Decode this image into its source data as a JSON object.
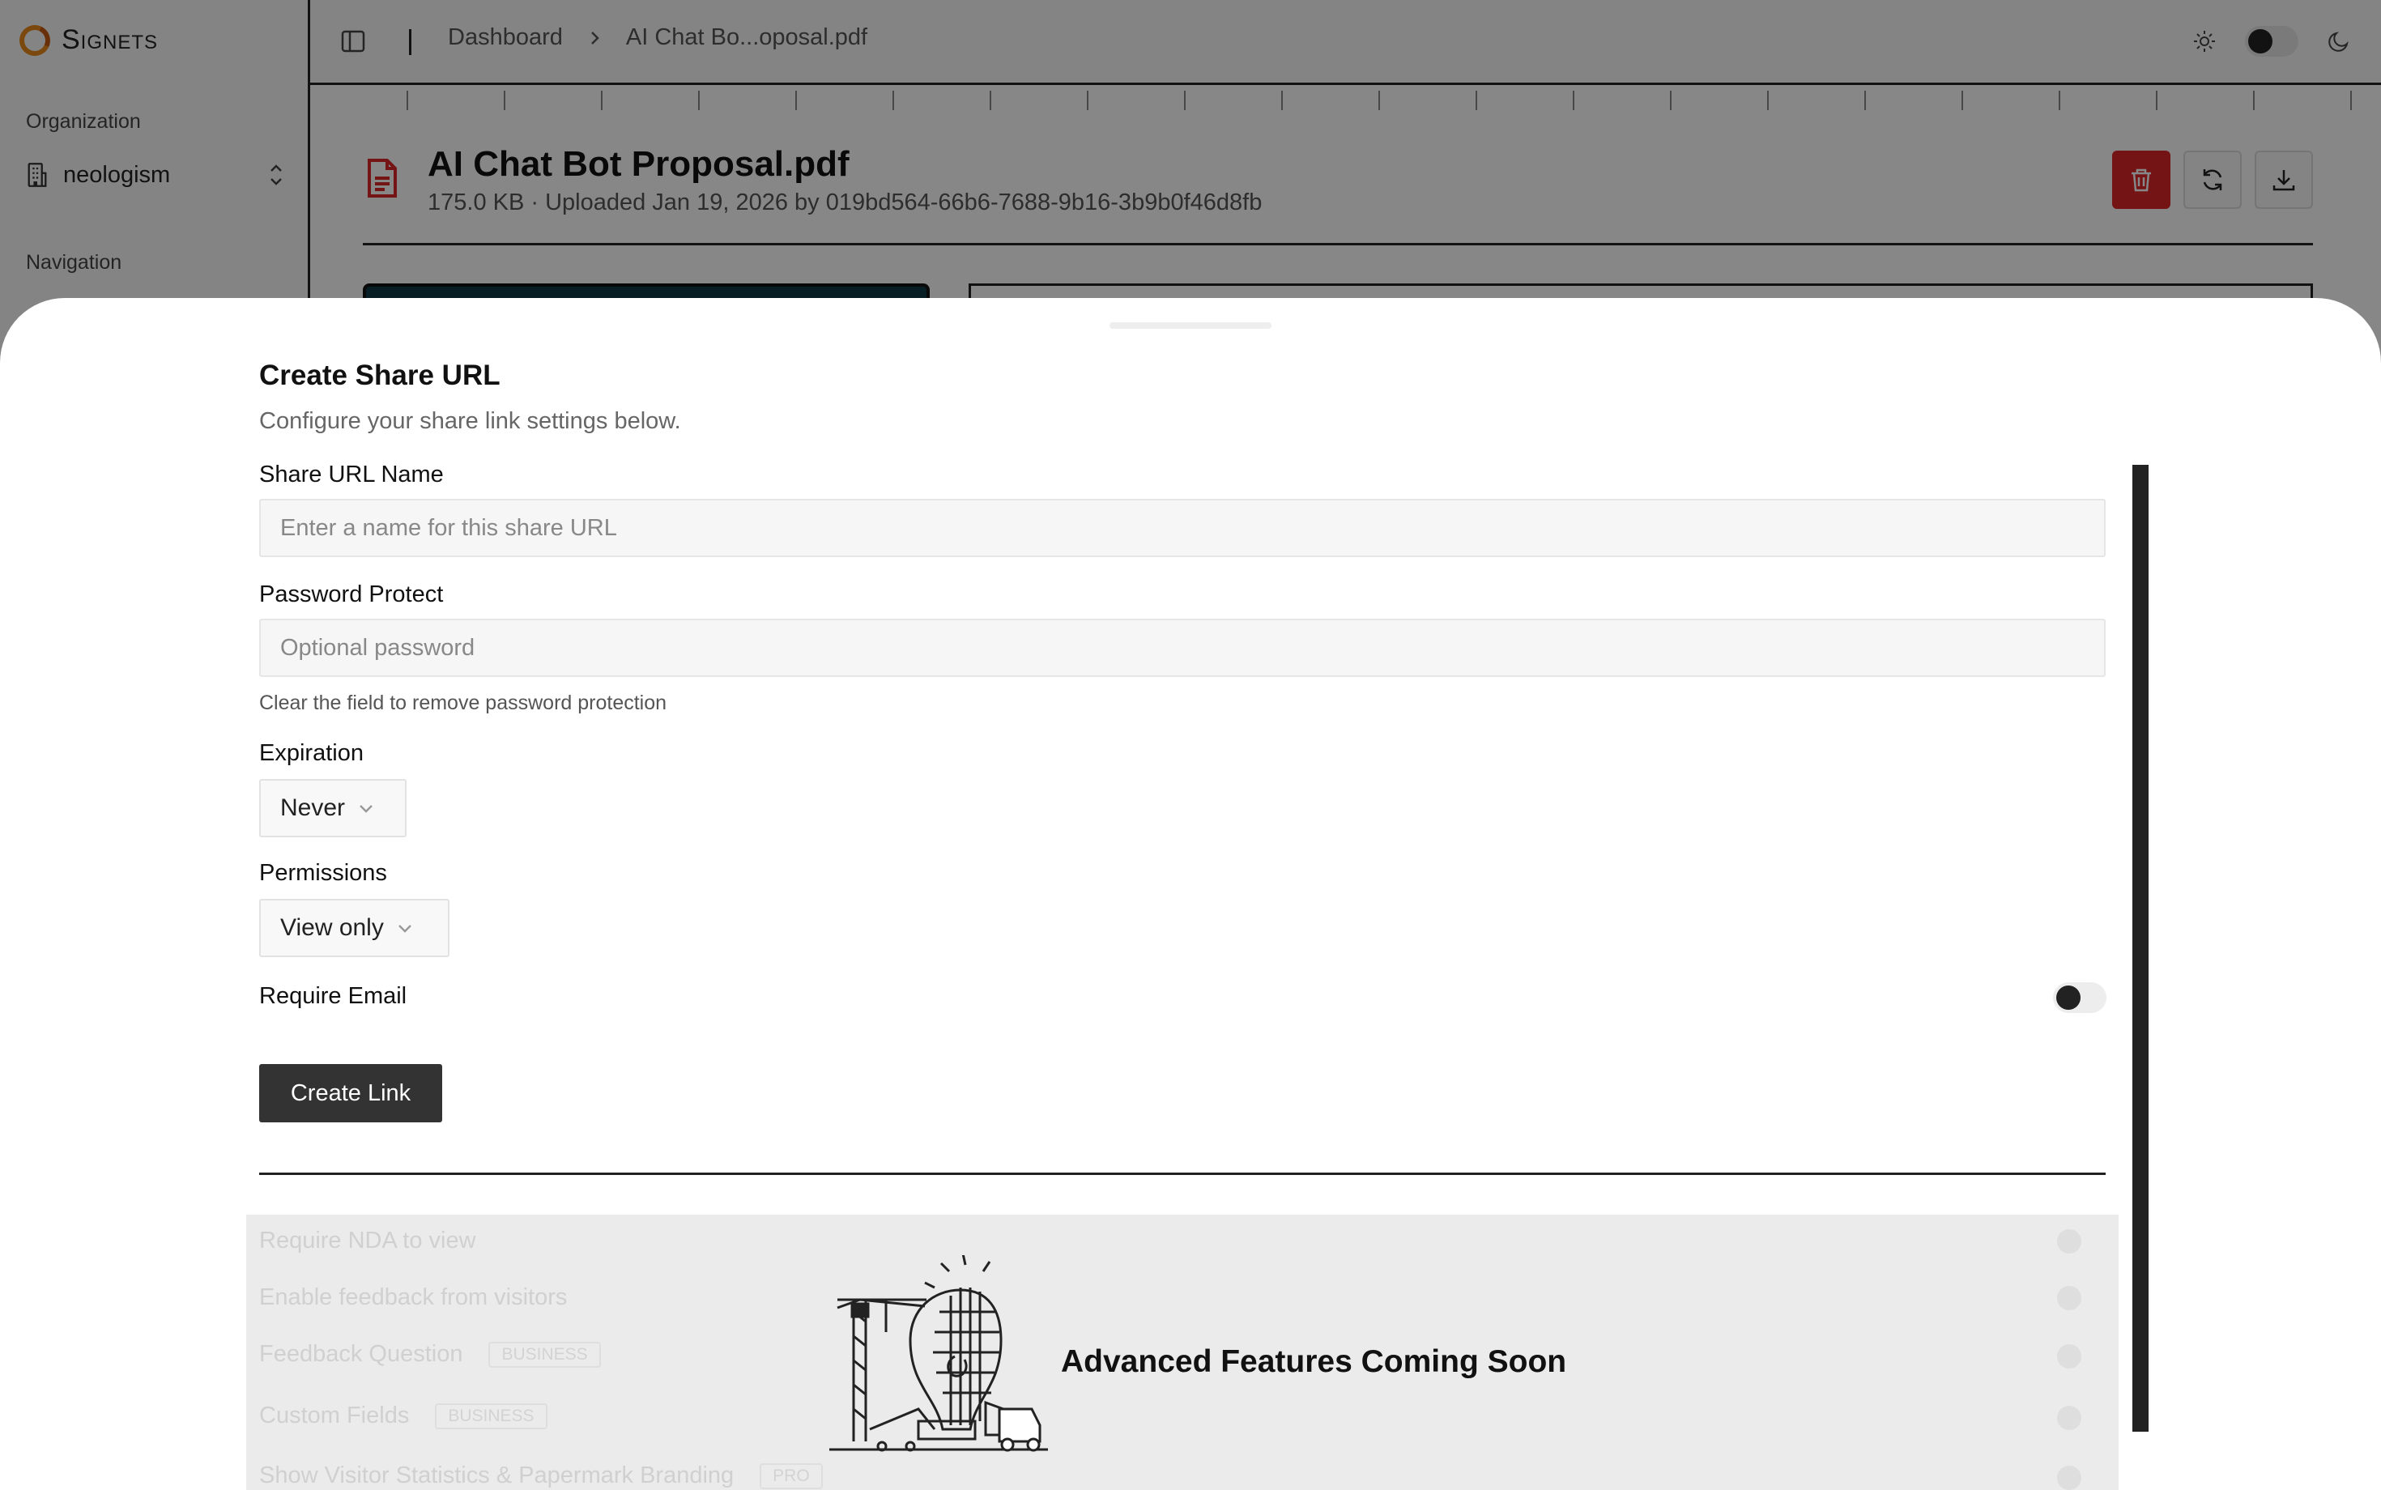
{
  "app": {
    "brand": "Signets"
  },
  "sidebar": {
    "organization_label": "Organization",
    "organization_name": "neologism",
    "navigation_label": "Navigation"
  },
  "topbar": {
    "breadcrumbs": [
      "Dashboard",
      "AI Chat Bo...oposal.pdf"
    ],
    "theme": "light"
  },
  "document": {
    "title": "AI Chat Bot Proposal.pdf",
    "meta": "175.0 KB · Uploaded Jan 19, 2026 by 019bd564-66b6-7688-9b16-3b9b0f46d8fb",
    "actions": [
      "trash-icon",
      "refresh-icon",
      "download-icon"
    ]
  },
  "share_drawer": {
    "title": "Create Share URL",
    "subtitle": "Configure your share link settings below.",
    "name_label": "Share URL Name",
    "name_value": "",
    "name_placeholder": "Enter a name for this share URL",
    "password_label": "Password Protect",
    "password_value": "",
    "password_placeholder": "Optional password",
    "password_help": "Clear the field to remove password protection",
    "expiration_label": "Expiration",
    "expiration_value": "Never",
    "permissions_label": "Permissions",
    "permissions_value": "View only",
    "require_email_label": "Require Email",
    "require_email_on": false,
    "create_button": "Create Link"
  },
  "advanced": {
    "title": "Advanced Features Coming Soon",
    "disabled_options": [
      {
        "label": "Require NDA to view",
        "badge": ""
      },
      {
        "label": "Enable feedback from visitors",
        "badge": ""
      },
      {
        "label": "Feedback Question",
        "badge": "BUSINESS"
      },
      {
        "label": "Custom Fields",
        "badge": "BUSINESS"
      },
      {
        "label": "Show Visitor Statistics & Papermark Branding",
        "badge": "PRO"
      }
    ]
  },
  "colors": {
    "danger": "#dc2626",
    "primary_button": "#333333",
    "brand": "#e8891a"
  }
}
